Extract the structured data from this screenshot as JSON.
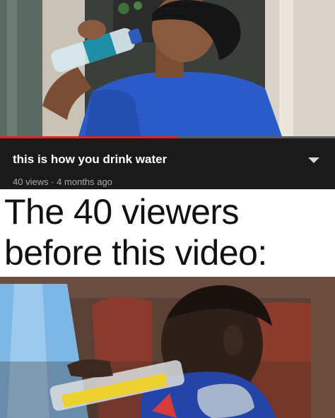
{
  "video": {
    "title": "this is how you drink water",
    "meta": "40 views · 4 months ago",
    "progress": 0.53
  },
  "caption": {
    "line1": "The 40 viewers",
    "line2": "before this video:"
  },
  "colors": {
    "progress": "#e62117",
    "info_bg": "#1a1a1a",
    "shirt": "#2a5bc8"
  },
  "icons": {
    "more": "chevron-down-icon"
  }
}
